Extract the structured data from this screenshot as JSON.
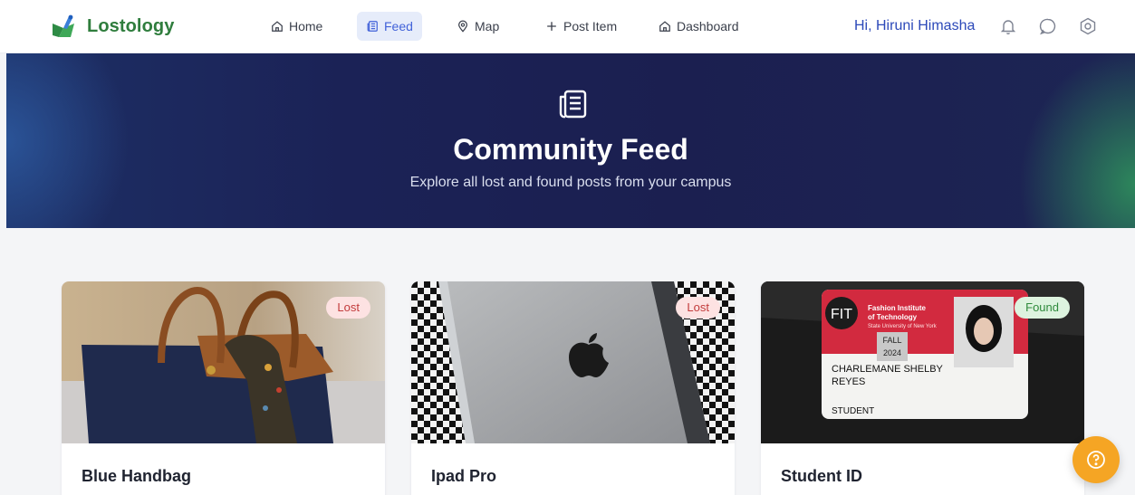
{
  "brand": {
    "name": "Lostology",
    "color": "#2f7d3d"
  },
  "nav": {
    "items": [
      {
        "label": "Home",
        "icon": "home-icon"
      },
      {
        "label": "Feed",
        "icon": "newspaper-icon",
        "active": true
      },
      {
        "label": "Map",
        "icon": "map-pin-icon"
      },
      {
        "label": "Post Item",
        "icon": "plus-icon"
      },
      {
        "label": "Dashboard",
        "icon": "home-icon"
      }
    ],
    "greeting": "Hi, Hiruni Himasha"
  },
  "hero": {
    "icon": "newspaper-icon",
    "title": "Community Feed",
    "subtitle": "Explore all lost and found posts from your campus"
  },
  "cards": [
    {
      "title": "Blue Handbag",
      "status": "Lost"
    },
    {
      "title": "Ipad Pro",
      "status": "Lost"
    },
    {
      "title": "Student ID",
      "status": "Found",
      "id_card": {
        "org_initials": "FIT",
        "org_line1": "Fashion Institute",
        "org_line2": "of Technology",
        "org_line3": "State University of New York",
        "term": "FALL",
        "year": "2024",
        "name_line1": "CHARLEMANE SHELBY",
        "name_line2": "REYES",
        "role": "STUDENT"
      }
    }
  ],
  "colors": {
    "accent": "#4262d9",
    "hero_bg": "#1b1f50",
    "lost_badge": "#c23b3b",
    "found_badge": "#2f8a3c",
    "fab": "#f5a524"
  },
  "fab": {
    "icon": "help-circle-icon"
  }
}
